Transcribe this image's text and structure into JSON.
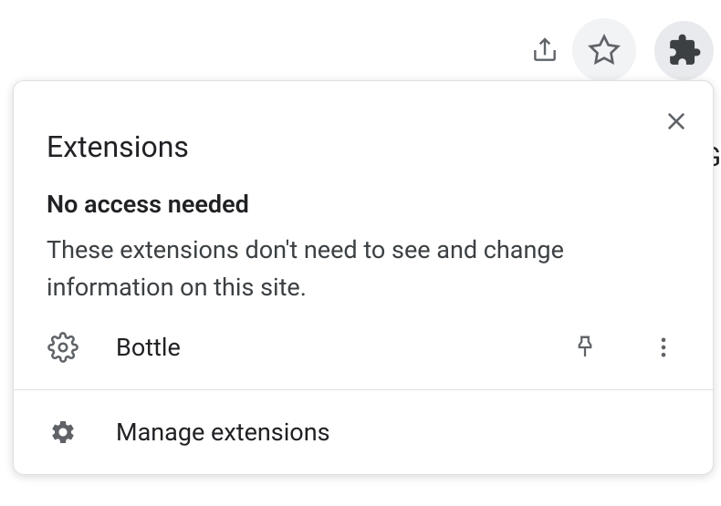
{
  "toolbar": {
    "share_icon": "share",
    "star_icon": "star",
    "puzzle_icon": "puzzle"
  },
  "popup": {
    "title": "Extensions",
    "close_icon": "close",
    "section_heading": "No access needed",
    "section_desc": "These extensions don't need to see and change information on this site.",
    "extension": {
      "icon": "gear-outline",
      "name": "Bottle",
      "pin_icon": "pushpin",
      "more_icon": "more-vertical"
    },
    "footer": {
      "icon": "gear-filled",
      "label": "Manage extensions"
    }
  },
  "background_letter": "G"
}
